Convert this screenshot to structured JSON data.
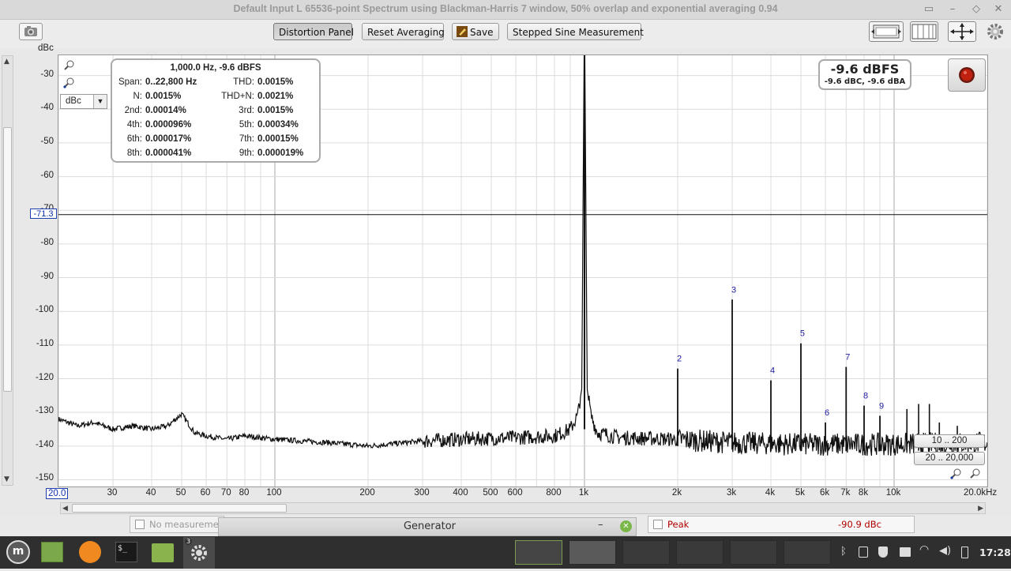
{
  "window": {
    "title": "Default Input L 65536-point Spectrum using Blackman-Harris 7 window, 50% overlap and exponential averaging 0.94"
  },
  "toolbar": {
    "distortion_panel": "Distortion Panel",
    "reset_averaging": "Reset Averaging",
    "save": "Save",
    "stepped_sine": "Stepped Sine Measurement"
  },
  "icons": {
    "capture": "camera-icon",
    "save": "pencil-icon",
    "settings": "gear-icon",
    "zoom": "magnifier-icon"
  },
  "y_unit": {
    "label": "dBc",
    "selector_value": "dBc"
  },
  "cursor": {
    "value_label": "-71.3",
    "level": -71.3
  },
  "distortion": {
    "header": "1,000.0 Hz, -9.6 dBFS",
    "rows": [
      {
        "l1": "Span:",
        "v1": "0..22,800 Hz",
        "l2": "THD:",
        "v2": "0.0015%"
      },
      {
        "l1": "N:",
        "v1": "0.0015%",
        "l2": "THD+N:",
        "v2": "0.0021%"
      },
      {
        "l1": "2nd:",
        "v1": "0.00014%",
        "l2": "3rd:",
        "v2": "0.0015%"
      },
      {
        "l1": "4th:",
        "v1": "0.000096%",
        "l2": "5th:",
        "v2": "0.00034%"
      },
      {
        "l1": "6th:",
        "v1": "0.000017%",
        "l2": "7th:",
        "v2": "0.00015%"
      },
      {
        "l1": "8th:",
        "v1": "0.000041%",
        "l2": "9th:",
        "v2": "0.000019%"
      }
    ]
  },
  "peak_display": {
    "main": "-9.6 dBFS",
    "sub": "-9.6 dBC, -9.6 dBA"
  },
  "range_buttons": {
    "y_range": "10 .. 200",
    "x_range": "20 .. 20,000"
  },
  "status": {
    "no_measurement": "No measureme",
    "generator": "Generator",
    "peak_label": "Peak",
    "peak_value": "-90.9 dBc"
  },
  "taskbar": {
    "badge": "3",
    "clock": "17:28"
  },
  "colors": {
    "harmonic_label": "#1a1aa0",
    "peak_value": "#b00000",
    "record_button": "#c02010"
  },
  "chart_data": {
    "type": "line",
    "xlabel": "",
    "ylabel": "dBc",
    "x_scale": "log",
    "xlim": [
      20,
      20000
    ],
    "ylim": [
      -152,
      -24
    ],
    "x_ticks": [
      {
        "v": 20,
        "t": "20.0"
      },
      {
        "v": 30,
        "t": "30"
      },
      {
        "v": 40,
        "t": "40"
      },
      {
        "v": 50,
        "t": "50"
      },
      {
        "v": 60,
        "t": "60"
      },
      {
        "v": 70,
        "t": "70"
      },
      {
        "v": 80,
        "t": "80"
      },
      {
        "v": 100,
        "t": "100"
      },
      {
        "v": 200,
        "t": "200"
      },
      {
        "v": 300,
        "t": "300"
      },
      {
        "v": 400,
        "t": "400"
      },
      {
        "v": 500,
        "t": "500"
      },
      {
        "v": 600,
        "t": "600"
      },
      {
        "v": 800,
        "t": "800"
      },
      {
        "v": 1000,
        "t": "1k"
      },
      {
        "v": 2000,
        "t": "2k"
      },
      {
        "v": 3000,
        "t": "3k"
      },
      {
        "v": 4000,
        "t": "4k"
      },
      {
        "v": 5000,
        "t": "5k"
      },
      {
        "v": 6000,
        "t": "6k"
      },
      {
        "v": 7000,
        "t": "7k"
      },
      {
        "v": 8000,
        "t": "8k"
      },
      {
        "v": 10000,
        "t": "10k"
      },
      {
        "v": 20000,
        "t": "20.0kHz"
      }
    ],
    "y_ticks": [
      -30,
      -40,
      -50,
      -60,
      -70,
      -80,
      -90,
      -100,
      -110,
      -120,
      -130,
      -140,
      -150
    ],
    "noise_floor": [
      [
        20,
        -132
      ],
      [
        23,
        -134
      ],
      [
        26,
        -133
      ],
      [
        30,
        -135
      ],
      [
        35,
        -134
      ],
      [
        40,
        -135
      ],
      [
        45,
        -134
      ],
      [
        50,
        -130.5
      ],
      [
        55,
        -136
      ],
      [
        60,
        -137
      ],
      [
        70,
        -138
      ],
      [
        80,
        -137
      ],
      [
        100,
        -138
      ],
      [
        150,
        -139
      ],
      [
        200,
        -140
      ],
      [
        300,
        -138.5
      ],
      [
        400,
        -138
      ],
      [
        600,
        -137.5
      ],
      [
        800,
        -137
      ],
      [
        900,
        -135
      ],
      [
        950,
        -131
      ],
      [
        980,
        -123
      ],
      [
        1000,
        -9.6
      ],
      [
        1020,
        -123
      ],
      [
        1050,
        -131
      ],
      [
        1100,
        -136
      ],
      [
        1300,
        -137.5
      ],
      [
        2000,
        -138
      ],
      [
        3000,
        -139
      ],
      [
        5000,
        -139.5
      ],
      [
        10000,
        -139.5
      ],
      [
        20000,
        -139
      ]
    ],
    "harmonics": [
      {
        "n": 2,
        "f": 2000,
        "db": -117
      },
      {
        "n": 3,
        "f": 3000,
        "db": -96.5
      },
      {
        "n": 4,
        "f": 4000,
        "db": -120.5
      },
      {
        "n": 5,
        "f": 5000,
        "db": -109.5
      },
      {
        "n": 6,
        "f": 6000,
        "db": -133
      },
      {
        "n": 7,
        "f": 7000,
        "db": -116.5
      },
      {
        "n": 8,
        "f": 8000,
        "db": -128
      },
      {
        "n": 9,
        "f": 9000,
        "db": -131
      }
    ],
    "spurs": [
      {
        "f": 11000,
        "db": -129
      },
      {
        "f": 12000,
        "db": -127.5
      },
      {
        "f": 13000,
        "db": -127.5
      },
      {
        "f": 14000,
        "db": -133
      },
      {
        "f": 16000,
        "db": -134
      }
    ]
  }
}
